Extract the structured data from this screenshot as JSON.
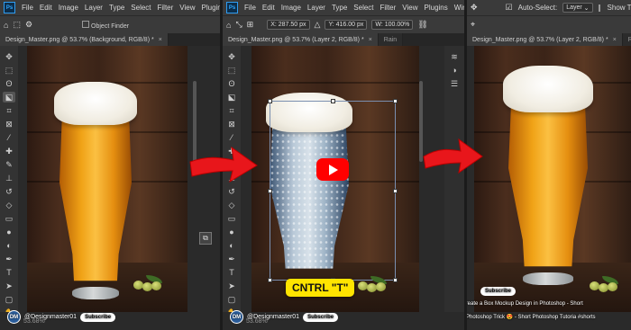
{
  "menu": {
    "items": [
      "File",
      "Edit",
      "Image",
      "Layer",
      "Type",
      "Select",
      "Filter",
      "View",
      "Plugins",
      "Window"
    ]
  },
  "panel1": {
    "option_label": "Object Finder",
    "tab": "Design_Master.png @ 53.7% (Background, RGB/8) *",
    "zoom": "53.68%",
    "channel_avatar": "DM",
    "channel_name": "@Designmaster01",
    "subscribe": "Subscribe"
  },
  "panel2": {
    "x_label": "X:",
    "x_value": "287.50 px",
    "y_label": "Y:",
    "y_value": "416.00 px",
    "w_label": "W:",
    "w_value": "100.00%",
    "tab": "Design_Master.png @ 53.7% (Layer 2, RGB/8) *",
    "tab_inactive": "Rain",
    "caption": "CNTRL \"T\"",
    "zoom": "53.68%",
    "channel_avatar": "DM",
    "channel_name": "@Designmaster01",
    "subscribe": "Subscribe"
  },
  "panel3": {
    "auto_select": "Auto-Select:",
    "layer_select": "Layer",
    "show_transform": "Show Transfo",
    "tab": "Design_Master.png @ 53.7% (Layer 2, RGB/8) *",
    "tab_inactive": "Ra",
    "channel_avatar": "DM",
    "subscribe": "Subscribe",
    "video_title_1": "How to Create a Box Mockup Design in Photoshop - Short",
    "video_title_2": "Amazing Photoshop Trick 😍 - Short Photoshop Tutoria #shorts"
  },
  "colors": {
    "arrow": "#e8161b",
    "caption_bg": "#ffe400",
    "yt_red": "#ff0000"
  }
}
